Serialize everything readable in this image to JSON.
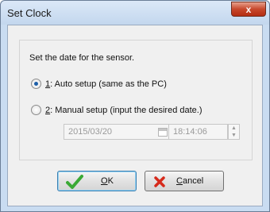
{
  "window": {
    "title": "Set Clock",
    "close_glyph": "x"
  },
  "dialog": {
    "prompt": "Set the date for the sensor.",
    "options": [
      {
        "key": "1",
        "label": ": Auto setup (same as the PC)",
        "selected": true
      },
      {
        "key": "2",
        "label": ": Manual setup (input the desired date.)",
        "selected": false
      }
    ],
    "date_value": "2015/03/20",
    "time_value": "18:14:06"
  },
  "buttons": {
    "ok": {
      "key": "O",
      "rest": "K"
    },
    "cancel": {
      "key": "C",
      "rest": "ancel"
    }
  },
  "icons": {
    "ok": "checkmark-icon",
    "cancel": "x-icon",
    "calendar": "calendar-icon"
  },
  "colors": {
    "ok_check": "#3aa935",
    "cancel_x": "#d62a1b",
    "radio_selected": "#1d5fa8"
  }
}
